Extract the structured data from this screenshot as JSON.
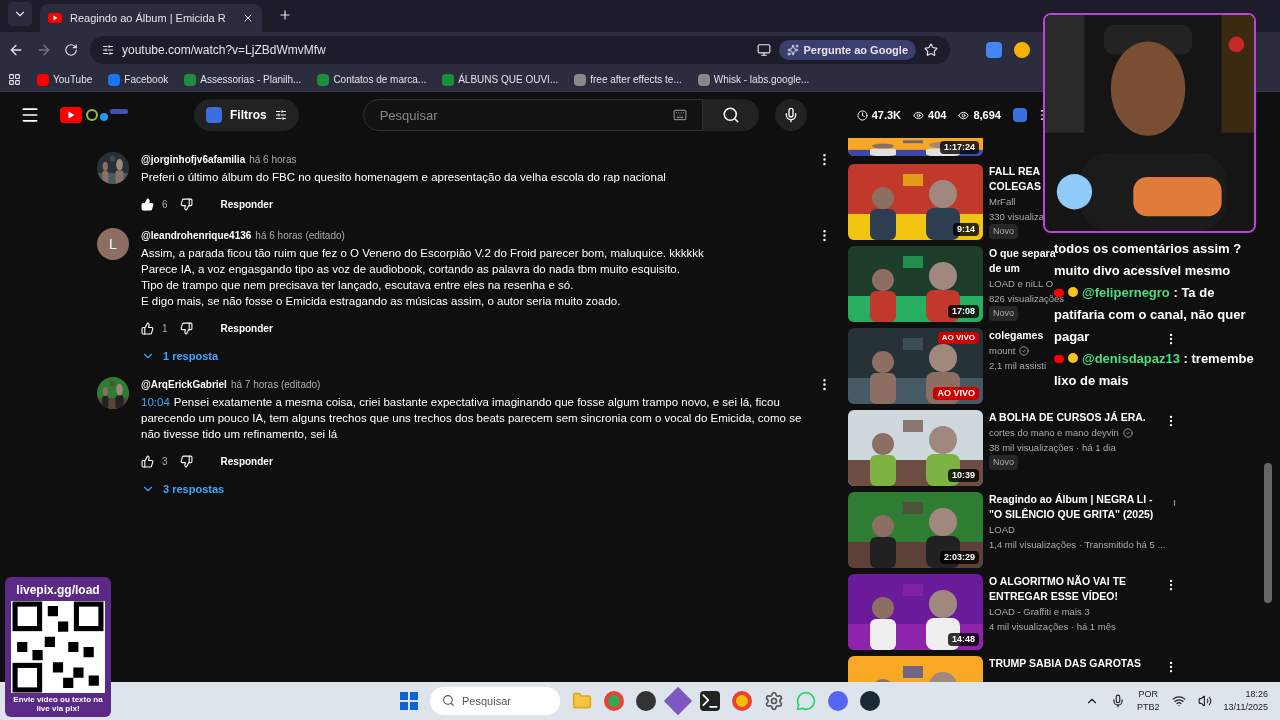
{
  "browser": {
    "tab": {
      "title": "Reagindo ao Álbum | Emicida R",
      "selected": true
    },
    "address": "youtube.com/watch?v=LjZBdWmvMfw",
    "ask_google": "Pergunte ao Google",
    "bookmarks": [
      "YouTube",
      "Facebook",
      "Assessorias - Planilh...",
      "Contatos de marca...",
      "ÁLBUNS QUE OUVI...",
      "free after effects te...",
      "Whisk - labs.google..."
    ]
  },
  "youtube": {
    "filters": "Filtros",
    "search": {
      "placeholder": "Pesquisar"
    },
    "stats": [
      "47.3K",
      "404",
      "8,694"
    ]
  },
  "comments": [
    {
      "author": "@jorginhofjv6afamilia",
      "time": "há 6 horas",
      "lines": [
        "Preferi o último álbum do FBC no quesito homenagem e apresentação da velha escola do rap nacional"
      ],
      "likes": "6",
      "liked": true,
      "reply": "Responder"
    },
    {
      "author": "@leandrohenrique4136",
      "time": "há 6 horas (editado)",
      "letter": "L",
      "color": "#8d6e63",
      "lines": [
        "Assim, a parada ficou tão ruim que fez o O Veneno do Escorpião V.2 do Froid parecer bom, maluquice. kkkkkk",
        "Parece IA, a voz engasgando tipo as voz de audiobook, cortando as palavra do nada tbm muito esquisito.",
        "Tipo de trampo que nem precisava ter lançado, escutava entre eles na resenha e só.",
        "E digo mais, se não fosse o Emicida estragando as músicas assim, o autor seria muito zoado."
      ],
      "likes": "1",
      "liked": false,
      "reply": "Responder",
      "replies": "1 resposta"
    },
    {
      "author": "@ArqErickGabriel",
      "time": "há 7 horas (editado)",
      "timestamp": "10:04",
      "lines": [
        "Pensei exatamente a mesma coisa, criei bastante expectativa imaginando que fosse algum trampo novo, e sei lá, ficou parecendo um pouco IA, tem alguns trechos que uns trechos dos beats parecem sem sincronia com o vocal do Emicida, como se não tivesse tido um refinamento, sei lá"
      ],
      "likes": "3",
      "liked": false,
      "reply": "Responder",
      "replies": "3 respostas"
    }
  ],
  "sidebar": {
    "partial_duration": "1:17:24",
    "items": [
      {
        "title": [
          "FALL REA",
          "COLEGAS"
        ],
        "channel": "MrFall",
        "verified": false,
        "meta": "330 visualiza",
        "badge": "Novo",
        "duration": "9:14",
        "menu": false
      },
      {
        "title": [
          "O que separa",
          "de um"
        ],
        "channel": "LOAD e niLL O",
        "verified": false,
        "meta": "826 visualizações",
        "badge": "Novo",
        "duration": "17:08",
        "menu": false
      },
      {
        "title": [
          "colegames"
        ],
        "channel": "mount",
        "verified": true,
        "meta": "2,1 mil assisti",
        "live": [
          "AO VIVO",
          "AO VIVO"
        ],
        "menu": true
      },
      {
        "title": [
          "A BOLHA DE CURSOS JÁ ERA."
        ],
        "channel": "cortes do mano e mano deyvin",
        "verified": true,
        "meta": "38 mil visualizações · há 1 dia",
        "badge": "Novo",
        "duration": "10:39",
        "menu": true
      },
      {
        "title": [
          "Reagindo ao Álbum | NEGRA LI -",
          "\"O SILÊNCIO QUE GRITA\" (2025)"
        ],
        "channel": "LOAD",
        "verified": false,
        "meta": "1,4 mil visualizações · Transmitido há 5 ...",
        "duration": "2:03:29",
        "menu": true
      },
      {
        "title": [
          "O ALGORITMO NÃO VAI TE",
          "ENTREGAR ESSE VÍDEO!"
        ],
        "channel": "LOAD - Graffiti e mais 3",
        "verified": false,
        "meta": "4 mil visualizações · há 1 mês",
        "duration": "14:48",
        "menu": true
      },
      {
        "title": [
          "TRUMP SABIA DAS GAROTAS"
        ],
        "menu": true
      }
    ]
  },
  "chat": [
    {
      "kind": "text",
      "text": "todos os comentários assim ?"
    },
    {
      "kind": "text",
      "text": "muito divo acessível mesmo"
    },
    {
      "kind": "user",
      "user": "@felipernegro",
      "text": ": Ta de patifaria com o canal, não quer pagar"
    },
    {
      "kind": "user",
      "user": "@denisdapaz13",
      "text": ": tremembe lixo de mais"
    }
  ],
  "livepix": {
    "url": "livepix.gg/load",
    "caption": "Envie vídeo ou texto na live via pix!"
  },
  "taskbar": {
    "search": {
      "placeholder": "Pesquisar"
    },
    "language": [
      "POR",
      "PTB2"
    ],
    "time": "18:26",
    "date": "13/11/2025"
  }
}
